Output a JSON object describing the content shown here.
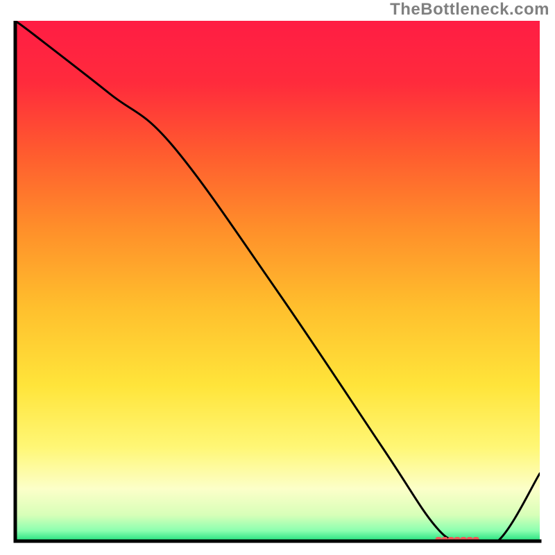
{
  "watermark": "TheBottleneck.com",
  "chart_data": {
    "type": "line",
    "title": "",
    "xlabel": "",
    "ylabel": "",
    "xlim": [
      0,
      100
    ],
    "ylim": [
      0,
      100
    ],
    "series": [
      {
        "name": "curve",
        "x": [
          0,
          4,
          18,
          30,
          50,
          70,
          80,
          85,
          92,
          100
        ],
        "y": [
          100,
          97,
          86,
          76,
          48,
          18,
          3,
          0,
          0,
          13
        ]
      }
    ],
    "marker_segment": {
      "x0": 80.5,
      "x1": 88.5,
      "y": 0.4
    },
    "background_gradient": {
      "stops": [
        {
          "pct": 0,
          "color": "#ff1d44"
        },
        {
          "pct": 12,
          "color": "#ff2b3c"
        },
        {
          "pct": 25,
          "color": "#ff5a2f"
        },
        {
          "pct": 40,
          "color": "#ff8f2a"
        },
        {
          "pct": 55,
          "color": "#ffbf2d"
        },
        {
          "pct": 70,
          "color": "#ffe43a"
        },
        {
          "pct": 82,
          "color": "#fff776"
        },
        {
          "pct": 90,
          "color": "#fcffc9"
        },
        {
          "pct": 95,
          "color": "#d7ffb8"
        },
        {
          "pct": 98,
          "color": "#8bffb0"
        },
        {
          "pct": 100,
          "color": "#20e27e"
        }
      ]
    },
    "axes_color": "#000000"
  }
}
